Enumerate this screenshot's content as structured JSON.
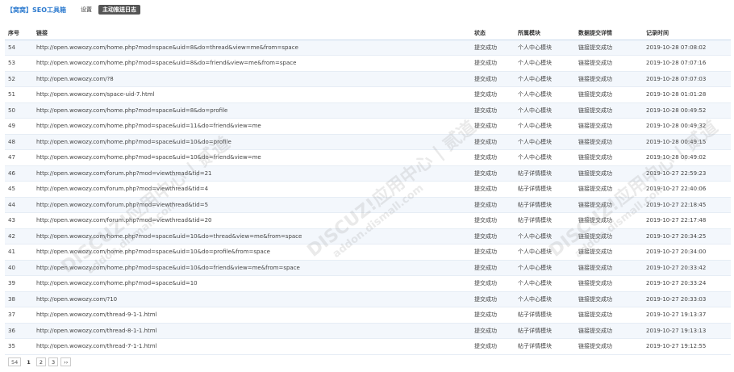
{
  "header": {
    "title": "【窝窝】SEO工具箱",
    "nav_settings": "设置",
    "nav_active": "主动推送日志"
  },
  "table": {
    "columns": [
      "序号",
      "链接",
      "状态",
      "所属模块",
      "数据提交详情",
      "记录时间"
    ],
    "rows": [
      [
        "54",
        "http://open.wowozy.com/home.php?mod=space&uid=8&do=thread&view=me&from=space",
        "提交成功",
        "个人中心模块",
        "链接提交成功",
        "2019-10-28 07:08:02"
      ],
      [
        "53",
        "http://open.wowozy.com/home.php?mod=space&uid=8&do=friend&view=me&from=space",
        "提交成功",
        "个人中心模块",
        "链接提交成功",
        "2019-10-28 07:07:16"
      ],
      [
        "52",
        "http://open.wowozy.com/?8",
        "提交成功",
        "个人中心模块",
        "链接提交成功",
        "2019-10-28 07:07:03"
      ],
      [
        "51",
        "http://open.wowozy.com/space-uid-7.html",
        "提交成功",
        "个人中心模块",
        "链接提交成功",
        "2019-10-28 01:01:28"
      ],
      [
        "50",
        "http://open.wowozy.com/home.php?mod=space&uid=8&do=profile",
        "提交成功",
        "个人中心模块",
        "链接提交成功",
        "2019-10-28 00:49:52"
      ],
      [
        "49",
        "http://open.wowozy.com/home.php?mod=space&uid=11&do=friend&view=me",
        "提交成功",
        "个人中心模块",
        "链接提交成功",
        "2019-10-28 00:49:32"
      ],
      [
        "48",
        "http://open.wowozy.com/home.php?mod=space&uid=10&do=profile",
        "提交成功",
        "个人中心模块",
        "链接提交成功",
        "2019-10-28 00:49:15"
      ],
      [
        "47",
        "http://open.wowozy.com/home.php?mod=space&uid=10&do=friend&view=me",
        "提交成功",
        "个人中心模块",
        "链接提交成功",
        "2019-10-28 00:49:02"
      ],
      [
        "46",
        "http://open.wowozy.com/forum.php?mod=viewthread&tid=21",
        "提交成功",
        "帖子详情模块",
        "链接提交成功",
        "2019-10-27 22:59:23"
      ],
      [
        "45",
        "http://open.wowozy.com/forum.php?mod=viewthread&tid=4",
        "提交成功",
        "帖子详情模块",
        "链接提交成功",
        "2019-10-27 22:40:06"
      ],
      [
        "44",
        "http://open.wowozy.com/forum.php?mod=viewthread&tid=5",
        "提交成功",
        "帖子详情模块",
        "链接提交成功",
        "2019-10-27 22:18:45"
      ],
      [
        "43",
        "http://open.wowozy.com/forum.php?mod=viewthread&tid=20",
        "提交成功",
        "帖子详情模块",
        "链接提交成功",
        "2019-10-27 22:17:48"
      ],
      [
        "42",
        "http://open.wowozy.com/home.php?mod=space&uid=10&do=thread&view=me&from=space",
        "提交成功",
        "个人中心模块",
        "链接提交成功",
        "2019-10-27 20:34:25"
      ],
      [
        "41",
        "http://open.wowozy.com/home.php?mod=space&uid=10&do=profile&from=space",
        "提交成功",
        "个人中心模块",
        "链接提交成功",
        "2019-10-27 20:34:00"
      ],
      [
        "40",
        "http://open.wowozy.com/home.php?mod=space&uid=10&do=friend&view=me&from=space",
        "提交成功",
        "个人中心模块",
        "链接提交成功",
        "2019-10-27 20:33:42"
      ],
      [
        "39",
        "http://open.wowozy.com/home.php?mod=space&uid=10",
        "提交成功",
        "个人中心模块",
        "链接提交成功",
        "2019-10-27 20:33:24"
      ],
      [
        "38",
        "http://open.wowozy.com/?10",
        "提交成功",
        "个人中心模块",
        "链接提交成功",
        "2019-10-27 20:33:03"
      ],
      [
        "37",
        "http://open.wowozy.com/thread-9-1-1.html",
        "提交成功",
        "帖子详情模块",
        "链接提交成功",
        "2019-10-27 19:13:37"
      ],
      [
        "36",
        "http://open.wowozy.com/thread-8-1-1.html",
        "提交成功",
        "帖子详情模块",
        "链接提交成功",
        "2019-10-27 19:13:13"
      ],
      [
        "35",
        "http://open.wowozy.com/thread-7-1-1.html",
        "提交成功",
        "帖子详情模块",
        "链接提交成功",
        "2019-10-27 19:12:55"
      ]
    ]
  },
  "pagination": {
    "total": "54",
    "pages": [
      "1",
      "2",
      "3"
    ],
    "current": "1",
    "next": "››"
  },
  "watermark": {
    "main": "DISCUZ!应用中心 | 贰道",
    "sub": "addon.dismall.com"
  }
}
